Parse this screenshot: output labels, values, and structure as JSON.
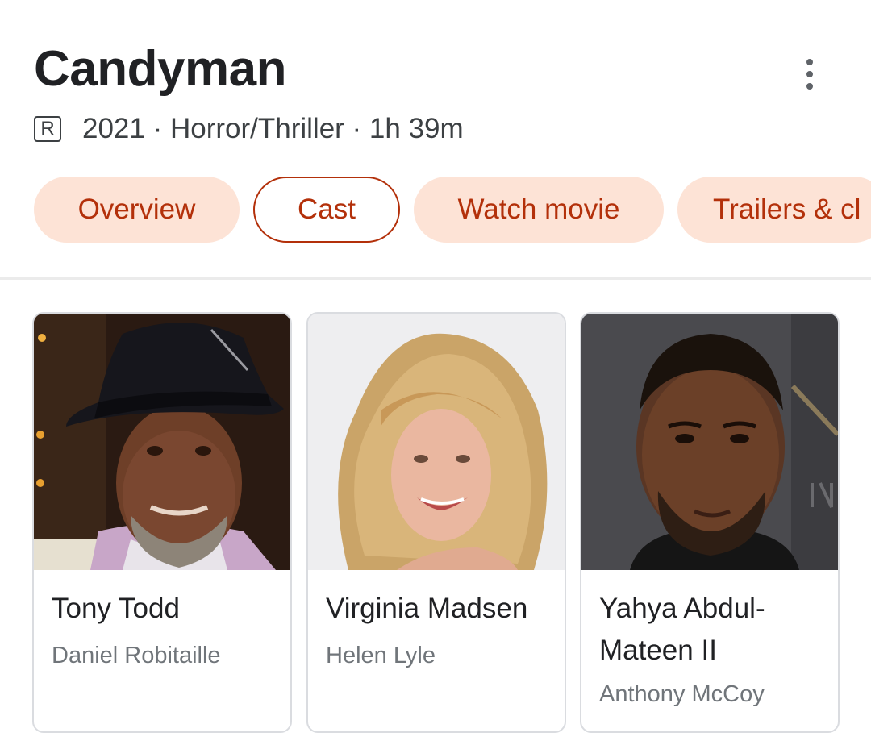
{
  "header": {
    "title": "Candyman",
    "rating": "R",
    "meta": "2021 · Horror/Thriller · 1h 39m"
  },
  "tabs": [
    {
      "label": "Overview",
      "selected": false
    },
    {
      "label": "Cast",
      "selected": true
    },
    {
      "label": "Watch movie",
      "selected": false
    },
    {
      "label": "Trailers & cl",
      "selected": false
    }
  ],
  "cast": [
    {
      "actor": "Tony Todd",
      "role": "Daniel Robitaille"
    },
    {
      "actor": "Virginia Madsen",
      "role": "Helen Lyle"
    },
    {
      "actor": "Yahya Abdul-Mateen II",
      "role": "Anthony McCoy"
    }
  ],
  "colors": {
    "accent": "#b3300a",
    "chip_background": "#fde3d6",
    "text_primary": "#202124",
    "text_secondary": "#70757a"
  },
  "icons": {
    "more": "more-vert-icon",
    "rating": "rating-r-icon"
  }
}
